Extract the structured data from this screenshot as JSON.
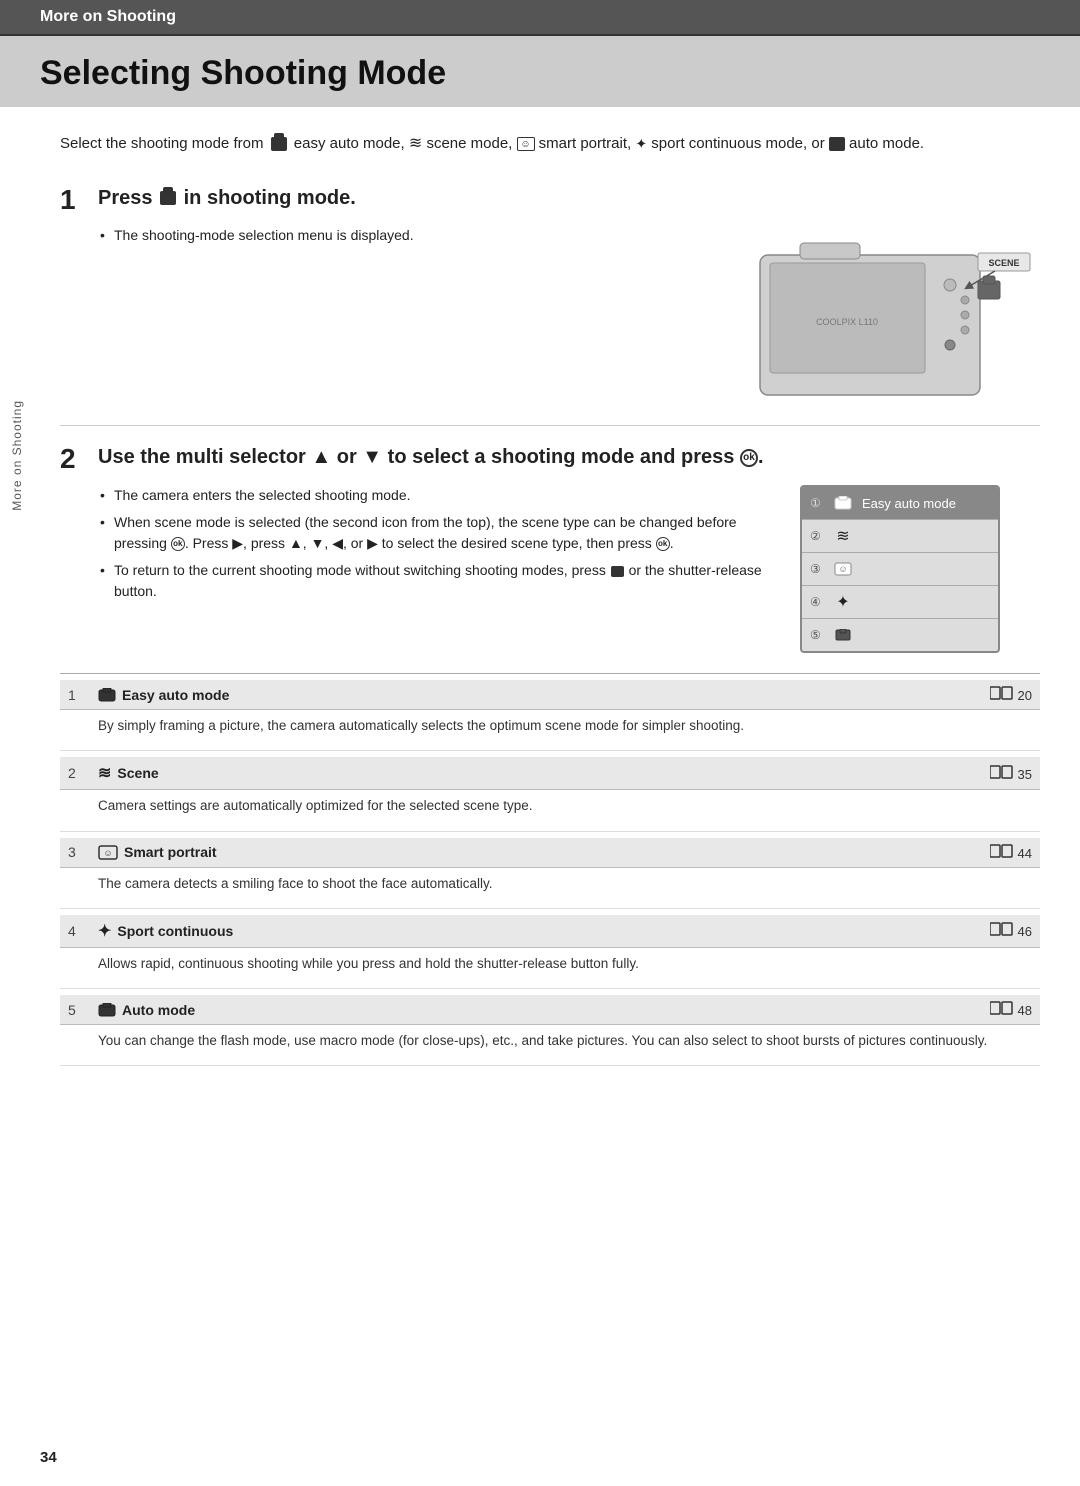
{
  "header": {
    "section_label": "More on Shooting"
  },
  "page_title": "Selecting Shooting Mode",
  "sidebar_label": "More on Shooting",
  "page_number": "34",
  "intro": {
    "text": "Select the shooting mode from easy auto mode, scene mode, smart portrait, sport continuous mode, or auto mode."
  },
  "steps": [
    {
      "number": "1",
      "title": "Press in shooting mode.",
      "bullets": [
        "The shooting-mode selection menu is displayed."
      ]
    },
    {
      "number": "2",
      "title": "Use the multi selector ▲ or ▼ to select a shooting mode and press .",
      "bullets": [
        "The camera enters the selected shooting mode.",
        "When scene mode is selected (the second icon from the top), the scene type can be changed before pressing . Press ▶, press ▲, ▼, ◀, or ▶ to select the desired scene type, then press .",
        "To return to the current shooting mode without switching shooting modes, press or the shutter-release button."
      ]
    }
  ],
  "menu_items": [
    {
      "num": "①",
      "label": "Easy auto mode",
      "highlighted": true
    },
    {
      "num": "②",
      "label": "",
      "highlighted": false
    },
    {
      "num": "③",
      "label": "",
      "highlighted": false
    },
    {
      "num": "④",
      "label": "",
      "highlighted": false
    },
    {
      "num": "⑤",
      "label": "",
      "highlighted": false
    }
  ],
  "table": {
    "rows": [
      {
        "num": "1",
        "icon": "🔲",
        "title": "Easy auto mode",
        "page": "□□ 20",
        "desc": "By simply framing a picture, the camera automatically selects the optimum scene mode for simpler shooting."
      },
      {
        "num": "2",
        "icon": "≋",
        "title": "Scene",
        "page": "□□ 35",
        "desc": "Camera settings are automatically optimized for the selected scene type."
      },
      {
        "num": "3",
        "icon": "☺",
        "title": "Smart portrait",
        "page": "□□ 44",
        "desc": "The camera detects a smiling face to shoot the face automatically."
      },
      {
        "num": "4",
        "icon": "✦",
        "title": "Sport continuous",
        "page": "□□ 46",
        "desc": "Allows rapid, continuous shooting while you press and hold the shutter-release button fully."
      },
      {
        "num": "5",
        "icon": "🅐",
        "title": "Auto mode",
        "page": "□□ 48",
        "desc": "You can change the flash mode, use macro mode (for close-ups), etc., and take pictures. You can also select to shoot bursts of pictures continuously."
      }
    ]
  }
}
